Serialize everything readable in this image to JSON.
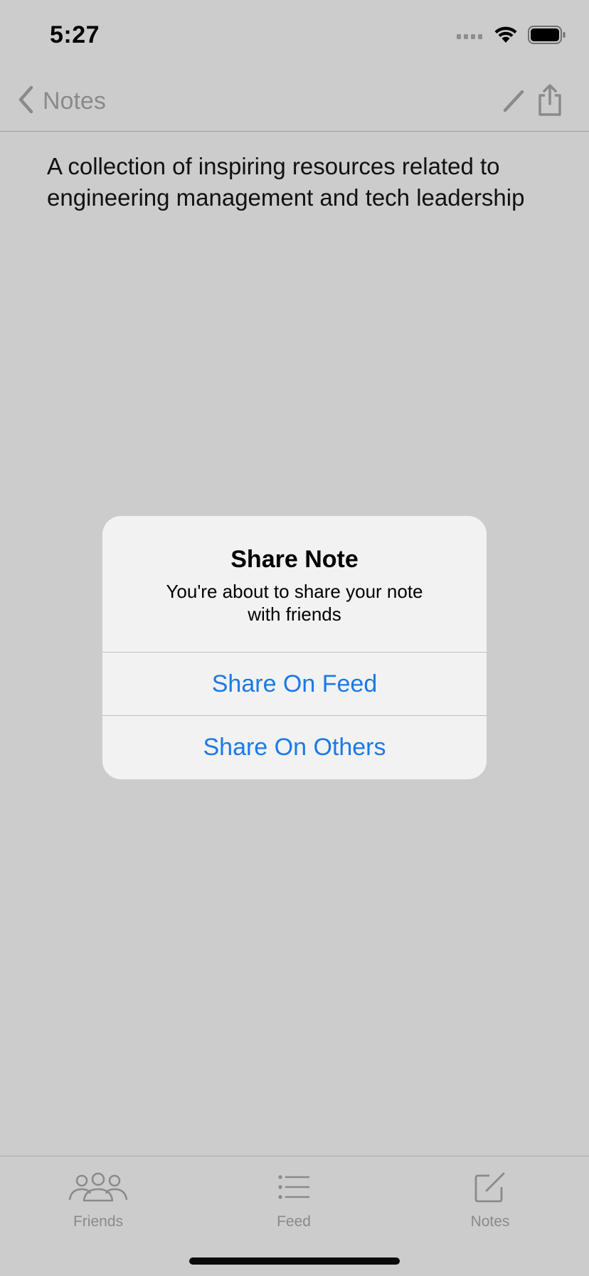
{
  "status_bar": {
    "time": "5:27",
    "icons": [
      "signal-icon",
      "wifi-icon",
      "battery-icon"
    ]
  },
  "nav_bar": {
    "back_label": "Notes",
    "back_icon": "chevron-left-icon",
    "actions": [
      "pencil-icon",
      "share-icon"
    ]
  },
  "note": {
    "text": "A collection of inspiring resources related to engineering management and tech leadership"
  },
  "alert": {
    "title": "Share Note",
    "message": "You're about to share your note with friends",
    "buttons": [
      "Share On Feed",
      "Share On Others"
    ],
    "button_color": "#1a7ae6"
  },
  "tab_bar": {
    "items": [
      {
        "label": "Friends",
        "icon": "friends-icon"
      },
      {
        "label": "Feed",
        "icon": "list-icon"
      },
      {
        "label": "Notes",
        "icon": "compose-icon"
      }
    ]
  },
  "colors": {
    "dim_background": "#cccccc",
    "alert_background": "#f2f2f2",
    "muted": "#8a8a8a"
  }
}
